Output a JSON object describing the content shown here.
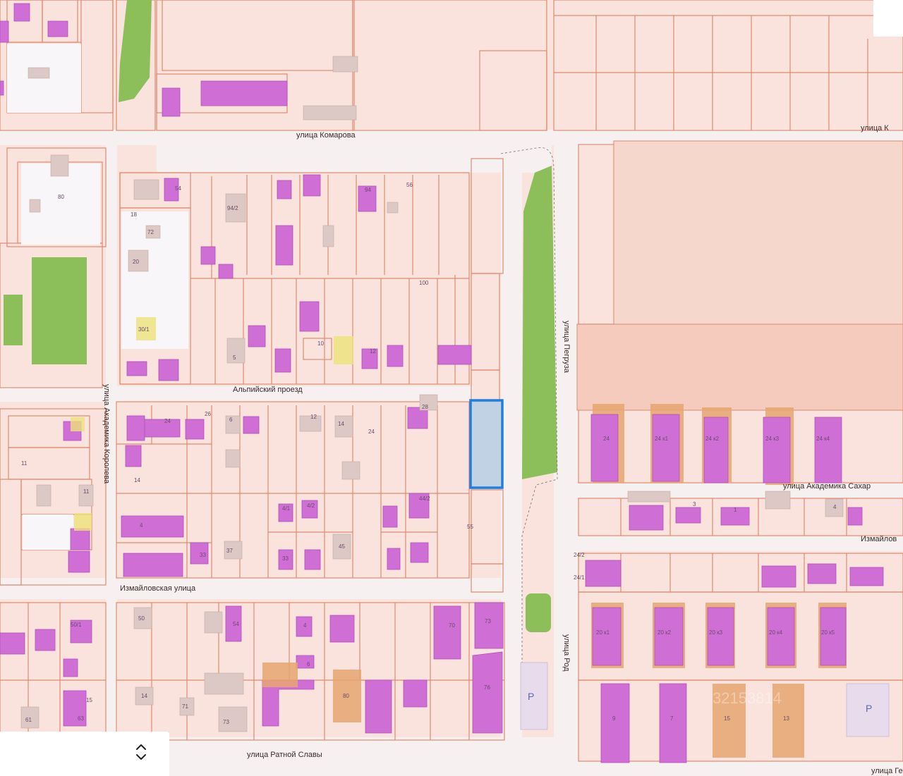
{
  "map": {
    "streets": {
      "komarova": "улица Комарова",
      "komarova_right": "улица К",
      "alpiyskiy": "Альпийский проезд",
      "akad_koroleva": "улица Академика Королева",
      "pegruza": "улица Пегруза",
      "akad_sakharova": "улица Академика Сахар",
      "izmailovskaya": "Измайловская улица",
      "izmailov_right": "Измайлов",
      "rod": "улица Род",
      "ratnoy_slavy": "улица Ратной Славы",
      "general": "улица Генера"
    },
    "house_numbers": [
      "94/2",
      "80",
      "54",
      "56",
      "18",
      "72",
      "20",
      "94",
      "100",
      "30/1",
      "5",
      "10",
      "12",
      "6",
      "12",
      "14",
      "24",
      "28",
      "11",
      "14",
      "4",
      "4/1",
      "4/2",
      "44/2",
      "45",
      "37",
      "33",
      "33",
      "50",
      "54",
      "14",
      "4",
      "6",
      "15",
      "61",
      "63",
      "50/1",
      "80",
      "71",
      "73",
      "70",
      "73",
      "76",
      "24",
      "24 к1",
      "24 к2",
      "24 к3",
      "24 к4",
      "20 к1",
      "20 к2",
      "20 к3",
      "20 к4",
      "20 к5",
      "9",
      "7",
      "15",
      "13",
      "55",
      "1",
      "3",
      "4",
      "11",
      "24/2",
      "24/1",
      "26",
      "24"
    ],
    "parking_label": "P",
    "watermark": "32153814"
  },
  "controls": {
    "icon": "sort-arrows-icon"
  },
  "colors": {
    "background": "#f9e3dc",
    "parcel_border": "#e08a6e",
    "building": "#c85bc8",
    "building_fill_light": "#cf70d8",
    "park": "#8cbf5a",
    "road": "#f6eeee",
    "selected": "#1f7fe0",
    "selected_fill": "#b8cfe6",
    "orange_building": "#e8a670"
  }
}
